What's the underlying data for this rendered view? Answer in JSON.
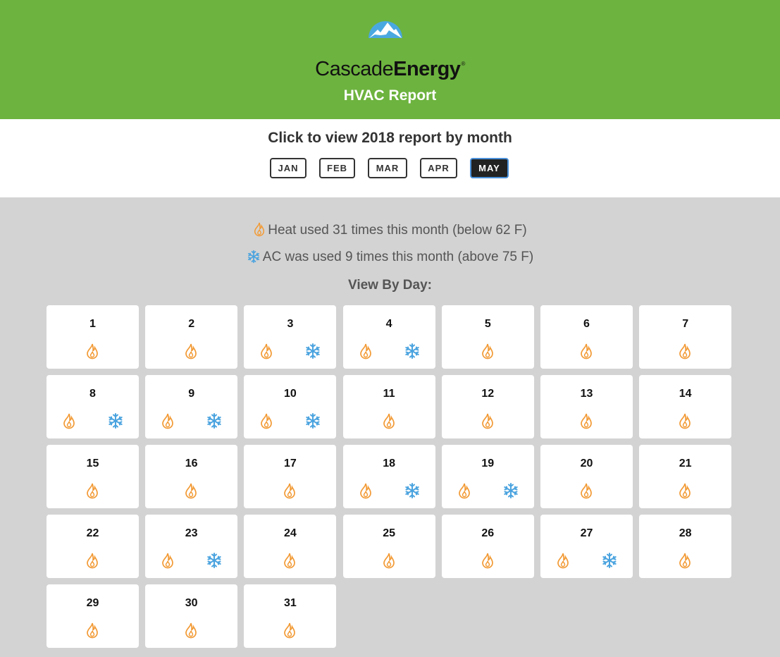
{
  "header": {
    "brand_light": "Cascade",
    "brand_bold": "Energy",
    "brand_mark": "®",
    "title": "HVAC Report"
  },
  "months": {
    "prompt": "Click to view 2018 report by month",
    "items": [
      "JAN",
      "FEB",
      "MAR",
      "APR",
      "MAY"
    ],
    "selected": "MAY"
  },
  "summary": {
    "heat_text": "Heat used 31 times this month (below 62 F)",
    "ac_text": "AC was used 9 times this month (above 75 F)",
    "view_by_label": "View By Day:"
  },
  "icons": {
    "heat": "flame-icon",
    "ac": "snowflake-icon",
    "heat_color": "#f29a35",
    "ac_color": "#4aa3df"
  },
  "days": [
    {
      "day": "1",
      "heat": true,
      "ac": false
    },
    {
      "day": "2",
      "heat": true,
      "ac": false
    },
    {
      "day": "3",
      "heat": true,
      "ac": true
    },
    {
      "day": "4",
      "heat": true,
      "ac": true
    },
    {
      "day": "5",
      "heat": true,
      "ac": false
    },
    {
      "day": "6",
      "heat": true,
      "ac": false
    },
    {
      "day": "7",
      "heat": true,
      "ac": false
    },
    {
      "day": "8",
      "heat": true,
      "ac": true
    },
    {
      "day": "9",
      "heat": true,
      "ac": true
    },
    {
      "day": "10",
      "heat": true,
      "ac": true
    },
    {
      "day": "11",
      "heat": true,
      "ac": false
    },
    {
      "day": "12",
      "heat": true,
      "ac": false
    },
    {
      "day": "13",
      "heat": true,
      "ac": false
    },
    {
      "day": "14",
      "heat": true,
      "ac": false
    },
    {
      "day": "15",
      "heat": true,
      "ac": false
    },
    {
      "day": "16",
      "heat": true,
      "ac": false
    },
    {
      "day": "17",
      "heat": true,
      "ac": false
    },
    {
      "day": "18",
      "heat": true,
      "ac": true
    },
    {
      "day": "19",
      "heat": true,
      "ac": true
    },
    {
      "day": "20",
      "heat": true,
      "ac": false
    },
    {
      "day": "21",
      "heat": true,
      "ac": false
    },
    {
      "day": "22",
      "heat": true,
      "ac": false
    },
    {
      "day": "23",
      "heat": true,
      "ac": true
    },
    {
      "day": "24",
      "heat": true,
      "ac": false
    },
    {
      "day": "25",
      "heat": true,
      "ac": false
    },
    {
      "day": "26",
      "heat": true,
      "ac": false
    },
    {
      "day": "27",
      "heat": true,
      "ac": true
    },
    {
      "day": "28",
      "heat": true,
      "ac": false
    },
    {
      "day": "29",
      "heat": true,
      "ac": false
    },
    {
      "day": "30",
      "heat": true,
      "ac": false
    },
    {
      "day": "31",
      "heat": true,
      "ac": false
    }
  ]
}
